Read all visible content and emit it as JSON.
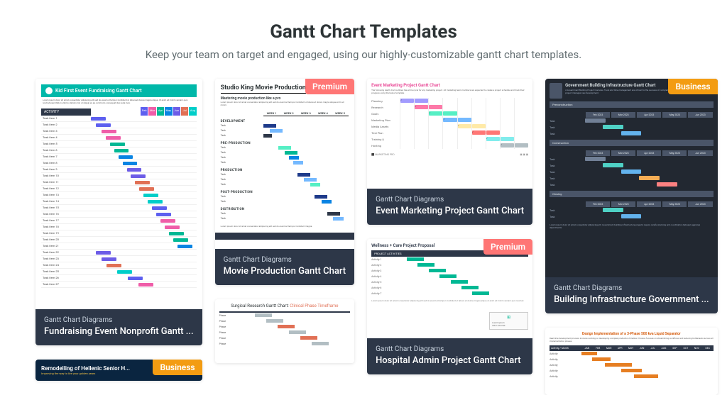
{
  "header": {
    "title": "Gantt Chart Templates",
    "subtitle": "Keep your team on target and engaged, using our highly-customizable gantt chart templates."
  },
  "badges": {
    "premium": "Premium",
    "business": "Business"
  },
  "category": "Gantt Chart Diagrams",
  "cards": {
    "c1": {
      "title": "Fundraising Event Nonprofit Gantt ...",
      "thumb_title": "Kid First Event Fundraising Gantt Chart",
      "section": "ACTIVITY",
      "months": [
        "Feb",
        "Mar",
        "Apr",
        "May",
        "Jun",
        "Jul",
        "Aug"
      ],
      "month_colors": [
        "#5d5fef",
        "#ef5da8",
        "#00b894",
        "#0984e3",
        "#6c5ce7",
        "#e17055",
        "#00cec9"
      ]
    },
    "c2": {
      "thumb_title": "Remodelling of Hellenic Senior H...",
      "thumb_sub": "Improving the way to live your golden years"
    },
    "c3": {
      "title": "Movie Production Gantt Chart",
      "thumb_title": "Studio King Movie Production",
      "thumb_sub": "Mastering movie production like a pro",
      "weeks": [
        "WEEK 1",
        "WEEK 2",
        "WEEK 3",
        "WEEK 4",
        "WEEK 5"
      ],
      "groups": [
        "DEVELOPMENT",
        "PRE-PRODUCTION",
        "PRODUCTION",
        "POST-PRODUCTION",
        "DISTRIBUTION"
      ]
    },
    "c4": {
      "thumb_title_a": "Surgical Research Gantt Chart: ",
      "thumb_title_b": "Clinical Phase Timeframe"
    },
    "c5": {
      "title": "Event Marketing Project Gantt Chart",
      "thumb_title": "Event Marketing Project Gantt Chart",
      "rows": [
        "Planning",
        "Research",
        "Goals",
        "Marketing Plan",
        "Media Assets",
        "Test Plan",
        "Training &",
        "Hosting"
      ],
      "logo": "MARKETING PRO"
    },
    "c6": {
      "title": "Hospital Admin Project Gantt Chart",
      "thumb_title": "Wellness + Care Project Proposal",
      "bar": "PROJECT ACTIVITIES"
    },
    "c7": {
      "title": "Building Infrastructure Government ...",
      "thumb_title": "Government Building Infrastructure Gantt Chart",
      "months": [
        "Feb 2023",
        "Mar 2023",
        "Apr 2023",
        "May 2023",
        "Jun 2023"
      ],
      "sects": [
        "Preconstruction",
        "Construction",
        "Closing"
      ]
    },
    "c8": {
      "thumb_title": "Design Implementation of a 3-Phase 500 kva Liquid Separator",
      "label": "Activity / Month",
      "months": [
        "JAN",
        "FEB",
        "MAR",
        "APR",
        "MAY",
        "JUN",
        "JUL",
        "AUG",
        "SEP",
        "OCT",
        "NOV",
        "DEC"
      ]
    }
  }
}
